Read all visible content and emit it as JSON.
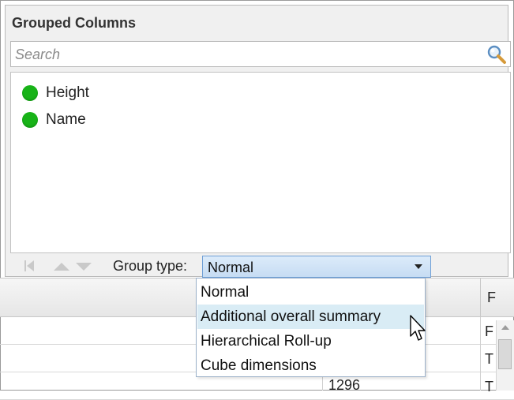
{
  "panel": {
    "title": "Grouped Columns",
    "search": {
      "placeholder": "Search",
      "value": ""
    },
    "columns": [
      {
        "label": "Height",
        "status_color": "#18b318"
      },
      {
        "label": "Name",
        "status_color": "#18b318"
      }
    ],
    "group_type": {
      "label": "Group type:",
      "selected": "Normal",
      "options": [
        "Normal",
        "Additional overall summary",
        "Hierarchical Roll-up",
        "Cube dimensions"
      ],
      "hovered_option": "Additional overall summary"
    }
  },
  "table": {
    "header_partial": "F",
    "rows": [
      {
        "right": "F"
      },
      {
        "right": "T"
      },
      {
        "right": "T"
      },
      {
        "mid": "1296",
        "right": "T"
      }
    ]
  },
  "colors": {
    "accent": "#6f9fd5",
    "hover": "#d9ecf5",
    "status_green": "#18b318"
  }
}
